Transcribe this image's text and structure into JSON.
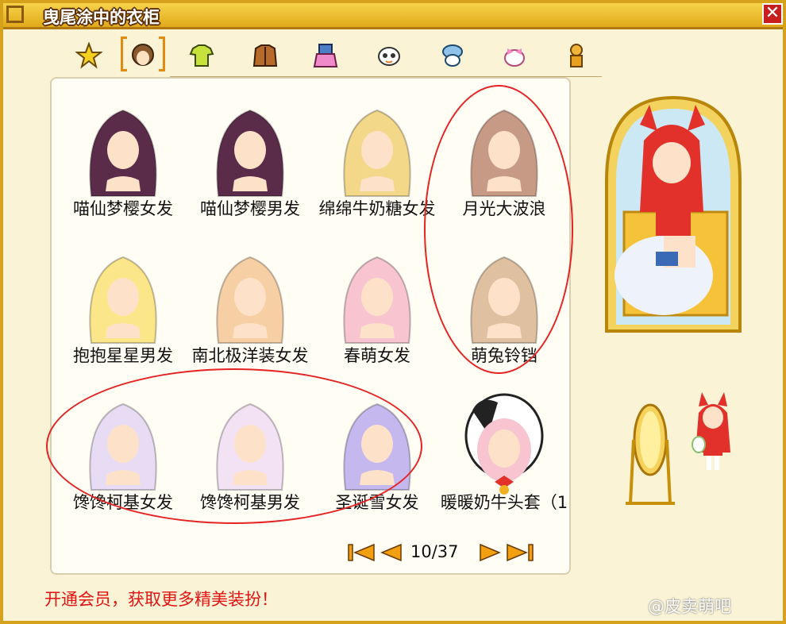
{
  "window": {
    "title": "曳尾涂中的衣柜",
    "close_glyph": "✕"
  },
  "tabs": [
    {
      "name": "star-icon",
      "active": false
    },
    {
      "name": "hair-icon",
      "active": true
    },
    {
      "name": "shirt-icon",
      "active": false
    },
    {
      "name": "coat-icon",
      "active": false
    },
    {
      "name": "pants-icon",
      "active": false
    },
    {
      "name": "face-icon",
      "active": false
    },
    {
      "name": "hat-icon",
      "active": false
    },
    {
      "name": "accessory-icon",
      "active": false
    },
    {
      "name": "doll-icon",
      "active": false
    }
  ],
  "items": [
    {
      "label": "喵仙梦樱女发",
      "color": "#5b2c4a"
    },
    {
      "label": "喵仙梦樱男发",
      "color": "#5b2c4a"
    },
    {
      "label": "绵绵牛奶糖女发",
      "color": "#f3d88a"
    },
    {
      "label": "月光大波浪",
      "color": "#c79a85"
    },
    {
      "label": "抱抱星星男发",
      "color": "#fbe68a"
    },
    {
      "label": "南北极洋装女发",
      "color": "#f7cfa4"
    },
    {
      "label": "春萌女发",
      "color": "#f7c4cf"
    },
    {
      "label": "萌兔铃铛",
      "color": "#dfc0a0"
    },
    {
      "label": "馋馋柯基女发",
      "color": "#e8dcf4"
    },
    {
      "label": "馋馋柯基男发",
      "color": "#f3e2f4"
    },
    {
      "label": "圣诞雪女发",
      "color": "#c5b8ee"
    },
    {
      "label": "暖暖奶牛头套（1",
      "color": "#222222"
    }
  ],
  "pager": {
    "text": "10/37"
  },
  "promo": "开通会员，获取更多精美装扮！",
  "watermark": "@皮卖萌吧",
  "colors": {
    "accent": "#d6a21c",
    "highlight": "#e52323"
  }
}
